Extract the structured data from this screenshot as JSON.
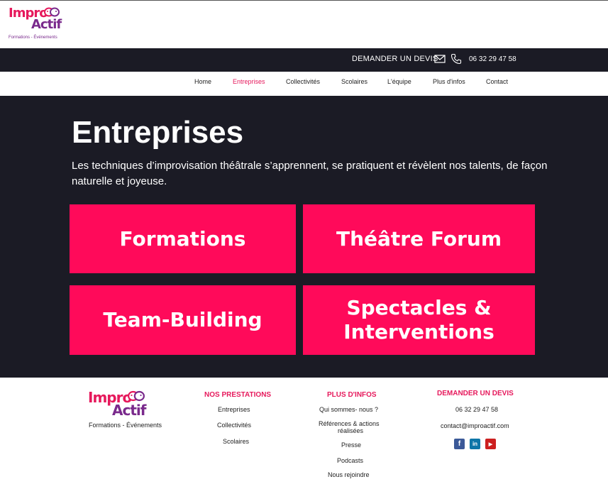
{
  "brand": {
    "logo_word1": "Impro",
    "logo_word2": "Actif",
    "tagline": "Formations - Événements"
  },
  "topbar": {
    "quote_label": "DEMANDER UN DEVIS",
    "mail_icon": "mail-icon",
    "phone_icon": "phone-icon",
    "phone": "06 32 29 47 58"
  },
  "nav": {
    "active_color": "#e6195c",
    "items": [
      {
        "label": "Home"
      },
      {
        "label": "Entreprises",
        "active": true
      },
      {
        "label": "Collectivités"
      },
      {
        "label": "Scolaires"
      },
      {
        "label": "L'équipe"
      },
      {
        "label": "Plus d'infos"
      },
      {
        "label": "Contact"
      }
    ]
  },
  "hero": {
    "title": "Entreprises",
    "lead": "Les techniques d’improvisation théâtrale s’apprennent, se pratiquent et révèlent nos talents, de façon naturelle et joyeuse.",
    "tiles": [
      {
        "label": "Formations"
      },
      {
        "label": "Théâtre Forum"
      },
      {
        "label": "Team-Building"
      },
      {
        "label_line1": "Spectacles &",
        "label_line2": "Interventions"
      }
    ],
    "tile_color": "#ff0a5a",
    "bg_color": "#1b1b25"
  },
  "footer": {
    "tagline": "Formations - Événements",
    "col1": {
      "heading": "NOS PRESTATIONS",
      "links": [
        "Entreprises",
        "Collectivités",
        "Scolaires"
      ]
    },
    "col2": {
      "heading": "PLUS D'INFOS",
      "links": [
        "Qui sommes- nous ?",
        "Références & actions",
        "réalisées",
        "Presse",
        "Podcasts",
        "Nous rejoindre"
      ]
    },
    "col3": {
      "heading": "DEMANDER UN DEVIS",
      "phone": "06 32 29 47 58",
      "email": "contact@improactif.com"
    },
    "social": [
      {
        "icon": "facebook-icon",
        "glyph": "f",
        "color": "#3b5998"
      },
      {
        "icon": "linkedin-icon",
        "glyph": "in",
        "color": "#0e76a8"
      },
      {
        "icon": "youtube-icon",
        "glyph": "▶",
        "color": "#cc1f1f"
      }
    ]
  }
}
